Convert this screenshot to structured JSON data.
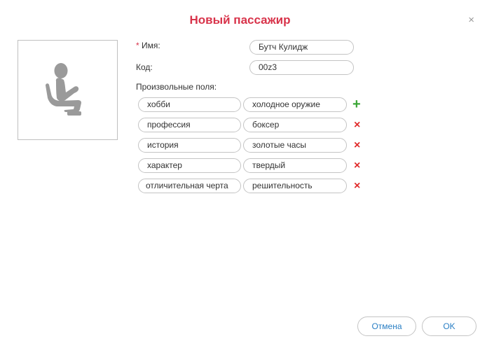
{
  "dialog": {
    "title": "Новый пассажир",
    "close_glyph": "×"
  },
  "form": {
    "name": {
      "required_mark": "*",
      "label": "Имя:",
      "value": "Бутч Кулидж"
    },
    "code": {
      "label": "Код:",
      "value": "00z3"
    },
    "custom_fields_label": "Произвольные поля:",
    "custom_fields": [
      {
        "key": "хобби",
        "value": "холодное оружие",
        "action": "add"
      },
      {
        "key": "профессия",
        "value": "боксер",
        "action": "remove"
      },
      {
        "key": "история",
        "value": "золотые часы",
        "action": "remove"
      },
      {
        "key": "характер",
        "value": "твердый",
        "action": "remove"
      },
      {
        "key": "отличительная черта",
        "value": "решительность",
        "action": "remove"
      }
    ],
    "add_glyph": "+",
    "remove_glyph": "×"
  },
  "icons": {
    "avatar": "seated-passenger-icon"
  },
  "colors": {
    "title": "#d8334a",
    "add": "#3aa635",
    "remove": "#e02b2b",
    "button_text": "#2a7fc4"
  },
  "buttons": {
    "cancel": "Отмена",
    "ok": "OK"
  }
}
